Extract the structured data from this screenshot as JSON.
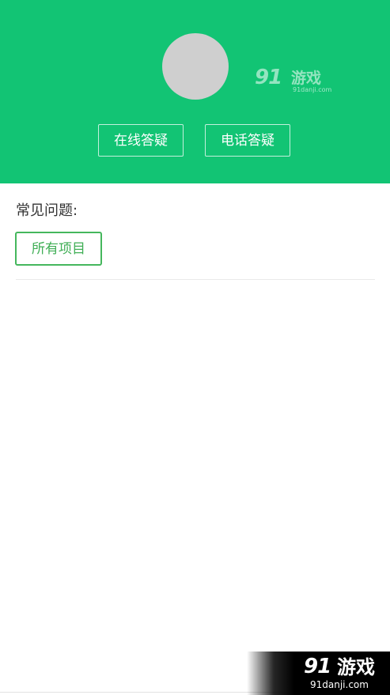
{
  "header": {
    "buttons": {
      "online": "在线答疑",
      "phone": "电话答疑"
    },
    "watermark": {
      "logo": "91",
      "name": "游戏",
      "url": "91danji.com"
    }
  },
  "faq": {
    "title": "常见问题:",
    "filter_button": "所有项目"
  },
  "corner_watermark": {
    "logo": "91",
    "name": "游戏",
    "url": "91danji.com"
  },
  "colors": {
    "header_bg": "#12c474",
    "accent": "#45b75d"
  }
}
